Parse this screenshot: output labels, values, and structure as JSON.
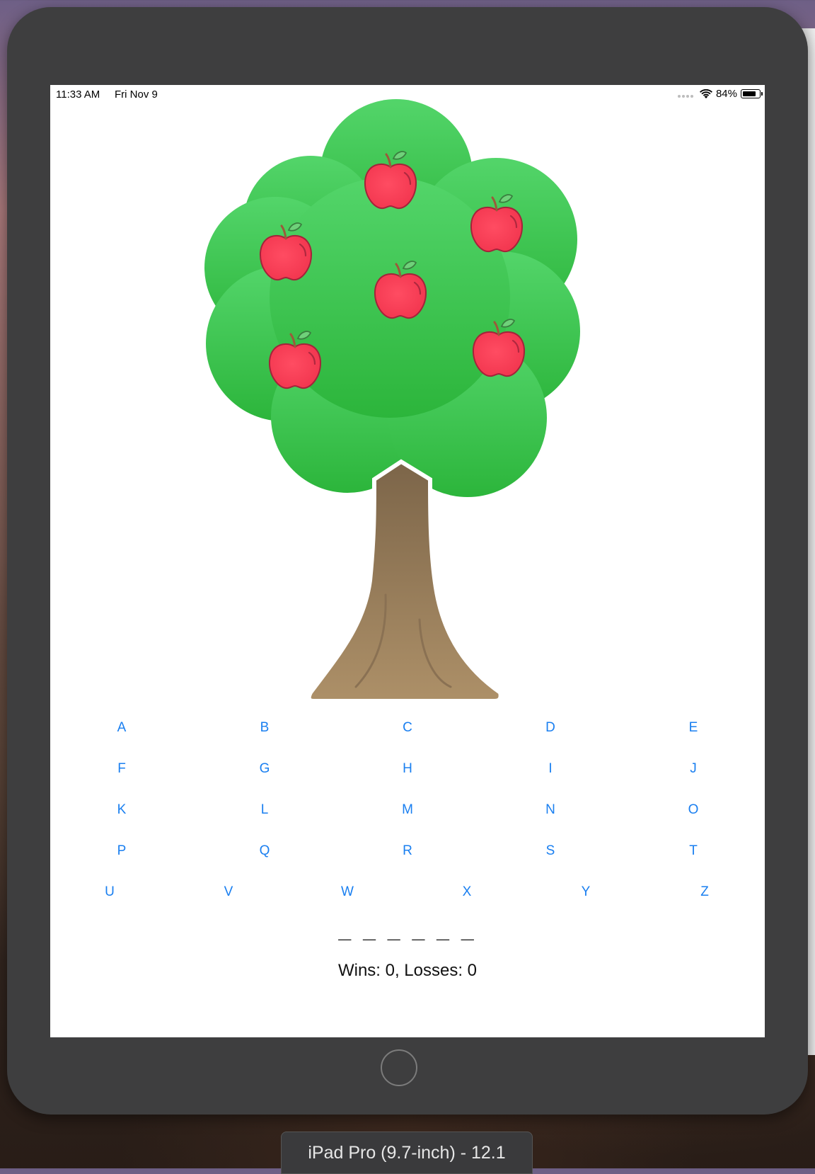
{
  "status_bar": {
    "time": "11:33 AM",
    "date": "Fri Nov 9",
    "battery": "84%",
    "battery_level": 0.84
  },
  "game": {
    "letters": [
      "A",
      "B",
      "C",
      "D",
      "E",
      "F",
      "G",
      "H",
      "I",
      "J",
      "K",
      "L",
      "M",
      "N",
      "O",
      "P",
      "Q",
      "R",
      "S",
      "T",
      "U",
      "V",
      "W",
      "X",
      "Y",
      "Z"
    ],
    "word": "_ _ _ _ _ _",
    "score": "Wins: 0, Losses: 0",
    "apples_remaining": 6
  },
  "simulator": {
    "device_name": "iPad Pro (9.7-inch) - 12.1"
  },
  "colors": {
    "button_blue": "#1a7ff0",
    "foliage_top": "#53d56a",
    "foliage_bottom": "#2cb53b",
    "trunk_top": "#7c6549",
    "trunk_bottom": "#ad9068",
    "apple_red": "#ff3d55"
  }
}
